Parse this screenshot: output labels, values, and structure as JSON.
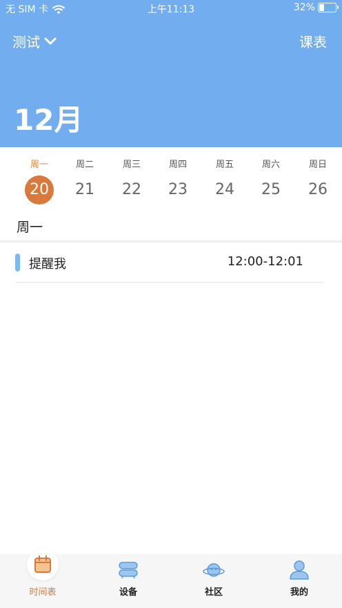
{
  "status_bar": {
    "carrier": "无 SIM 卡",
    "time": "上午11:13",
    "battery_percent": "32%",
    "battery_level": 0.32
  },
  "header": {
    "project_name": "测试",
    "schedule_link": "课表",
    "month": "12月"
  },
  "week": {
    "days": [
      {
        "weekday": "周一",
        "date": "20",
        "selected": true
      },
      {
        "weekday": "周二",
        "date": "21",
        "selected": false
      },
      {
        "weekday": "周三",
        "date": "22",
        "selected": false
      },
      {
        "weekday": "周四",
        "date": "23",
        "selected": false
      },
      {
        "weekday": "周五",
        "date": "24",
        "selected": false
      },
      {
        "weekday": "周六",
        "date": "25",
        "selected": false
      },
      {
        "weekday": "周日",
        "date": "26",
        "selected": false
      }
    ]
  },
  "content": {
    "section_title": "周一",
    "reminders": [
      {
        "title": "提醒我",
        "time": "12:00-12:01"
      }
    ]
  },
  "tabbar": {
    "tabs": [
      {
        "label": "时间表",
        "icon": "calendar-icon",
        "active": true
      },
      {
        "label": "设备",
        "icon": "device-icon",
        "active": false
      },
      {
        "label": "社区",
        "icon": "planet-icon",
        "active": false
      },
      {
        "label": "我的",
        "icon": "profile-icon",
        "active": false
      }
    ]
  },
  "colors": {
    "header_bg": "#72adef",
    "accent": "#d9793b",
    "reminder_bar": "#7cb9f1"
  }
}
